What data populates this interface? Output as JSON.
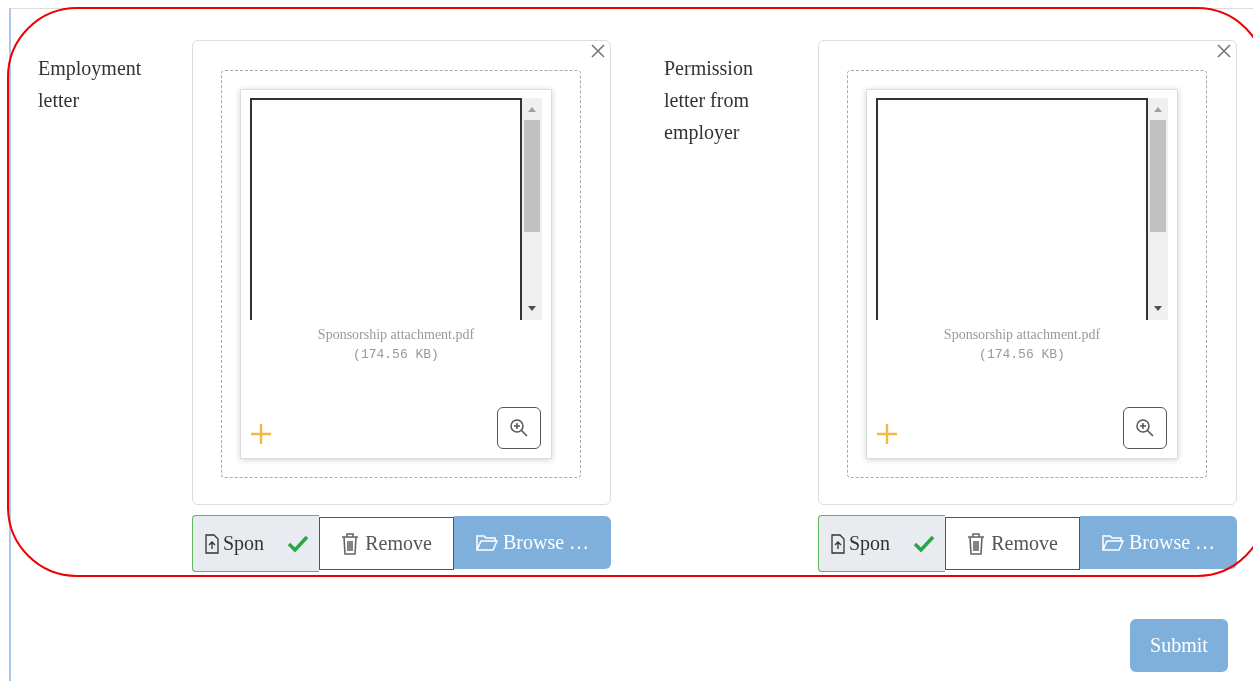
{
  "highlighted": true,
  "fields": [
    {
      "label": "Employment letter",
      "file_name": "Sponsorship attachment.pdf",
      "file_size": "(174.56 KB)",
      "caption": "Spon",
      "verified": true,
      "remove": "Remove",
      "browse": "Browse …"
    },
    {
      "label": "Permission letter from employer",
      "file_name": "Sponsorship attachment.pdf",
      "file_size": "(174.56 KB)",
      "caption": "Spon",
      "verified": true,
      "remove": "Remove",
      "browse": "Browse …"
    }
  ],
  "submit": "Submit"
}
